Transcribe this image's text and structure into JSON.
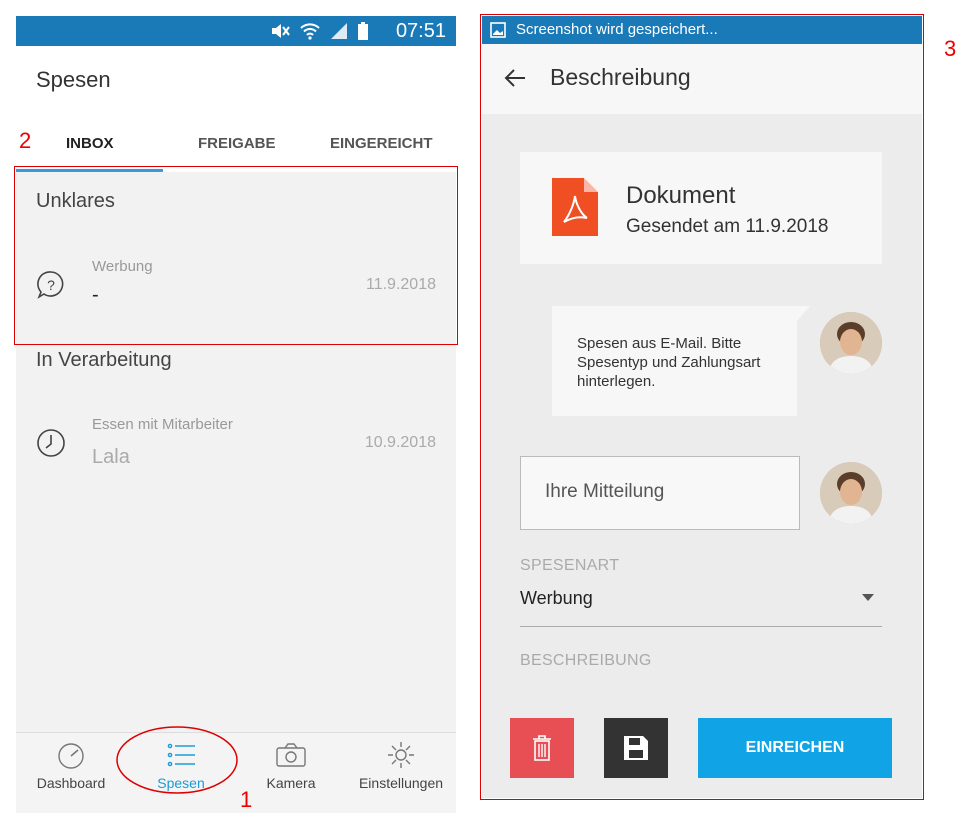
{
  "left_screen": {
    "status_bar": {
      "time": "07:51"
    },
    "app_title": "Spesen",
    "tabs": [
      {
        "label": "INBOX"
      },
      {
        "label": "FREIGABE"
      },
      {
        "label": "EINGEREICHT"
      }
    ],
    "sections": [
      {
        "heading": "Unklares",
        "items": [
          {
            "category": "Werbung",
            "value": "-",
            "date": "11.9.2018",
            "icon": "question-icon"
          }
        ]
      },
      {
        "heading": "In Verarbeitung",
        "items": [
          {
            "category": "Essen mit Mitarbeiter",
            "value": "Lala",
            "date": "10.9.2018",
            "icon": "clock-icon"
          }
        ]
      }
    ],
    "bottom_nav": [
      {
        "label": "Dashboard",
        "icon": "speedometer-icon"
      },
      {
        "label": "Spesen",
        "icon": "list-icon"
      },
      {
        "label": "Kamera",
        "icon": "camera-icon"
      },
      {
        "label": "Einstellungen",
        "icon": "gear-icon"
      }
    ]
  },
  "right_screen": {
    "status_bar": {
      "text": "Screenshot wird gespeichert..."
    },
    "app_bar": {
      "title": "Beschreibung"
    },
    "document": {
      "title": "Dokument",
      "subtitle": "Gesendet am  11.9.2018"
    },
    "message": {
      "text": "Spesen aus E-Mail. Bitte Spesentyp und Zahlungsart hinterlegen."
    },
    "input": {
      "placeholder": "Ihre Mitteilung"
    },
    "spesenart": {
      "label": "SPESENART",
      "value": "Werbung"
    },
    "beschreibung": {
      "label": "BESCHREIBUNG"
    },
    "buttons": {
      "submit": "EINREICHEN"
    }
  },
  "annotations": {
    "a1": "1",
    "a2": "2",
    "a3": "3"
  },
  "colors": {
    "accent": "#1a9bd7",
    "statusbar": "#1a7ab7",
    "delete": "#e84f55",
    "save": "#333333",
    "submit": "#10a3e6",
    "pdf": "#f04e23",
    "annotation": "#dd0000"
  }
}
